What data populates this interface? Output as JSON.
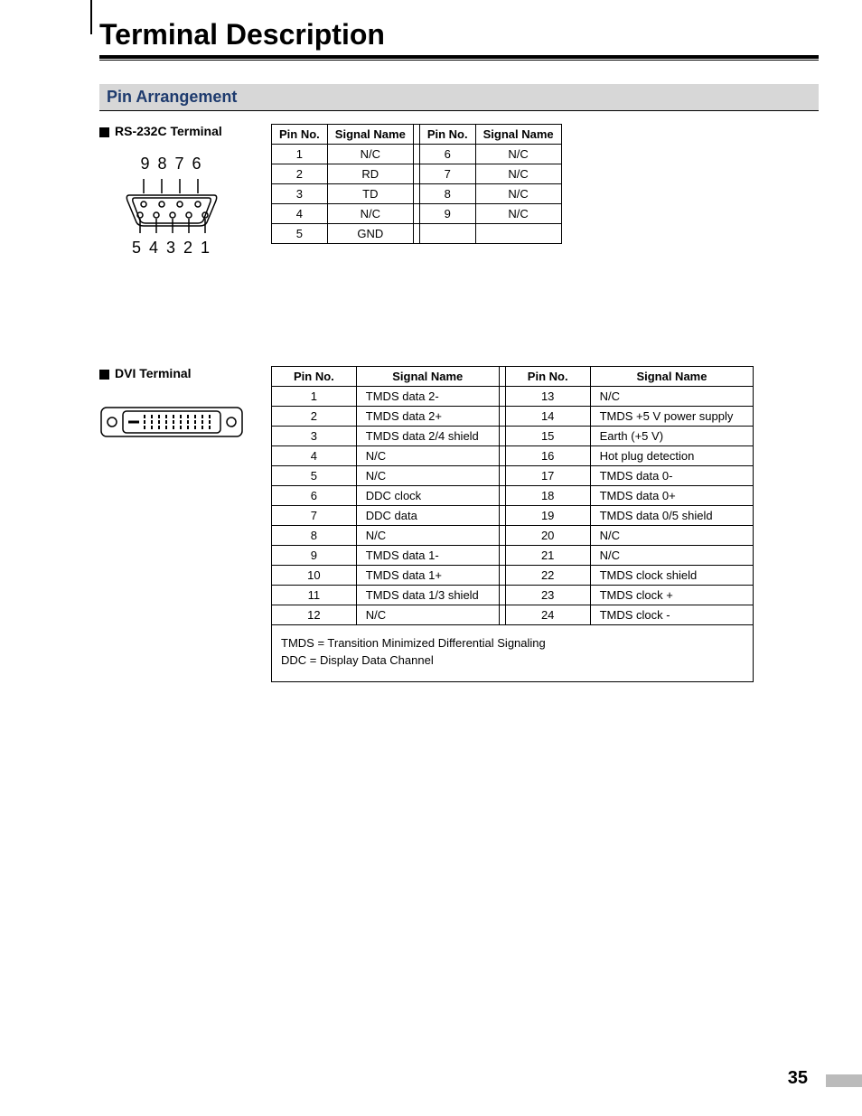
{
  "title": "Terminal Description",
  "section": "Pin Arrangement",
  "rs232": {
    "heading": "RS-232C Terminal",
    "top_nums": "9 8 7 6",
    "bottom_nums": "5 4 3 2 1",
    "th_pin": "Pin No.",
    "th_sig": "Signal Name",
    "left": [
      {
        "pin": "1",
        "sig": "N/C"
      },
      {
        "pin": "2",
        "sig": "RD"
      },
      {
        "pin": "3",
        "sig": "TD"
      },
      {
        "pin": "4",
        "sig": "N/C"
      },
      {
        "pin": "5",
        "sig": "GND"
      }
    ],
    "right": [
      {
        "pin": "6",
        "sig": "N/C"
      },
      {
        "pin": "7",
        "sig": "N/C"
      },
      {
        "pin": "8",
        "sig": "N/C"
      },
      {
        "pin": "9",
        "sig": "N/C"
      },
      {
        "pin": "",
        "sig": ""
      }
    ]
  },
  "dvi": {
    "heading": "DVI Terminal",
    "th_pin": "Pin No.",
    "th_sig": "Signal Name",
    "left": [
      {
        "pin": "1",
        "sig": "TMDS data 2-"
      },
      {
        "pin": "2",
        "sig": "TMDS data 2+"
      },
      {
        "pin": "3",
        "sig": "TMDS data 2/4 shield"
      },
      {
        "pin": "4",
        "sig": "N/C"
      },
      {
        "pin": "5",
        "sig": "N/C"
      },
      {
        "pin": "6",
        "sig": "DDC clock"
      },
      {
        "pin": "7",
        "sig": "DDC data"
      },
      {
        "pin": "8",
        "sig": "N/C"
      },
      {
        "pin": "9",
        "sig": "TMDS data 1-"
      },
      {
        "pin": "10",
        "sig": "TMDS data 1+"
      },
      {
        "pin": "11",
        "sig": "TMDS data 1/3 shield"
      },
      {
        "pin": "12",
        "sig": "N/C"
      }
    ],
    "right": [
      {
        "pin": "13",
        "sig": "N/C"
      },
      {
        "pin": "14",
        "sig": "TMDS +5 V power supply"
      },
      {
        "pin": "15",
        "sig": "Earth (+5 V)"
      },
      {
        "pin": "16",
        "sig": "Hot plug detection"
      },
      {
        "pin": "17",
        "sig": "TMDS data 0-"
      },
      {
        "pin": "18",
        "sig": "TMDS data 0+"
      },
      {
        "pin": "19",
        "sig": "TMDS data 0/5 shield"
      },
      {
        "pin": "20",
        "sig": "N/C"
      },
      {
        "pin": "21",
        "sig": "N/C"
      },
      {
        "pin": "22",
        "sig": "TMDS clock shield"
      },
      {
        "pin": "23",
        "sig": "TMDS clock +"
      },
      {
        "pin": "24",
        "sig": "TMDS clock -"
      }
    ],
    "note1": "TMDS = Transition Minimized Differential Signaling",
    "note2": "DDC = Display Data Channel"
  },
  "page_number": "35"
}
